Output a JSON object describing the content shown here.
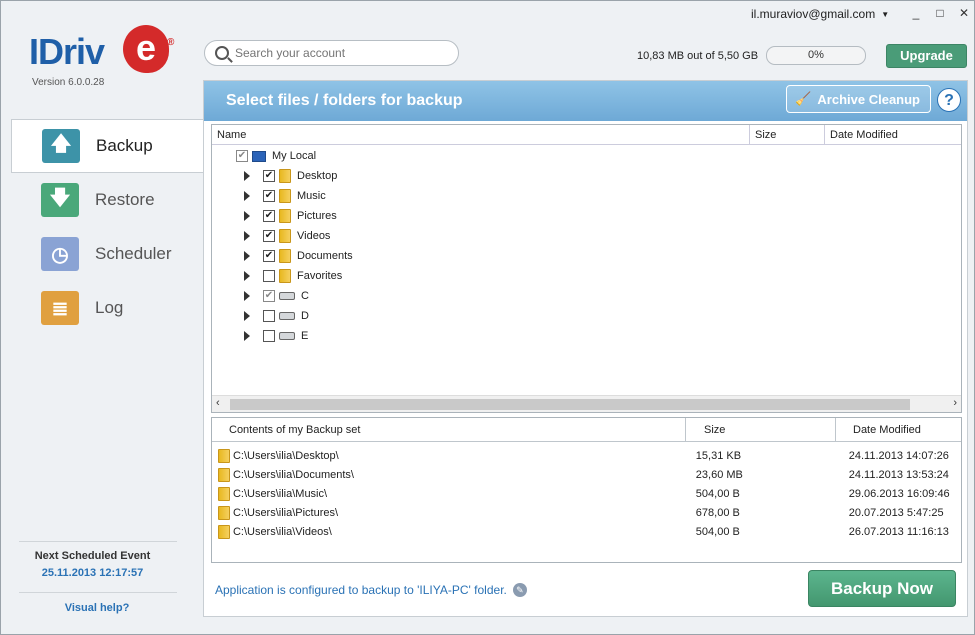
{
  "account": {
    "email": "il.muraviov@gmail.com"
  },
  "window_controls": [
    "_",
    "□",
    "✕"
  ],
  "logo": {
    "text": "IDriv",
    "e": "e",
    "reg": "®",
    "version": "Version  6.0.0.28"
  },
  "search": {
    "placeholder": "Search your account"
  },
  "quota": {
    "text": "10,83 MB out of 5,50 GB",
    "progress_label": "0%",
    "progress_value": 0
  },
  "upgrade_label": "Upgrade",
  "sidebar": {
    "items": [
      {
        "label": "Backup",
        "icon": "backup-arrow-up-icon",
        "active": true
      },
      {
        "label": "Restore",
        "icon": "restore-arrow-down-icon",
        "active": false
      },
      {
        "label": "Scheduler",
        "icon": "clock-icon",
        "active": false
      },
      {
        "label": "Log",
        "icon": "document-icon",
        "active": false
      }
    ],
    "next_event_label": "Next Scheduled Event",
    "next_event_time": "25.11.2013 12:17:57",
    "visual_help": "Visual help?"
  },
  "panel": {
    "title": "Select  files / folders  for  backup",
    "archive_cleanup": "Archive Cleanup",
    "help": "?"
  },
  "tree": {
    "columns": [
      "Name",
      "Size",
      "Date Modified"
    ],
    "root": {
      "label": "My Local",
      "checked": "partial"
    },
    "items": [
      {
        "label": "Desktop",
        "type": "folder",
        "checked": "yes"
      },
      {
        "label": "Music",
        "type": "folder",
        "checked": "yes"
      },
      {
        "label": "Pictures",
        "type": "folder",
        "checked": "yes"
      },
      {
        "label": "Videos",
        "type": "folder",
        "checked": "yes"
      },
      {
        "label": "Documents",
        "type": "folder",
        "checked": "yes"
      },
      {
        "label": "Favorites",
        "type": "folder",
        "checked": "no"
      },
      {
        "label": "C",
        "type": "drive",
        "checked": "partial"
      },
      {
        "label": "D",
        "type": "drive",
        "checked": "no"
      },
      {
        "label": "E",
        "type": "drive",
        "checked": "no"
      }
    ]
  },
  "backup_set": {
    "columns": [
      "Contents of my Backup set",
      "Size",
      "Date Modified"
    ],
    "rows": [
      {
        "path": "C:\\Users\\ilia\\Desktop\\",
        "size": "15,31 KB",
        "date": "24.11.2013 14:07:26"
      },
      {
        "path": "C:\\Users\\ilia\\Documents\\",
        "size": "23,60 MB",
        "date": "24.11.2013 13:53:24"
      },
      {
        "path": "C:\\Users\\ilia\\Music\\",
        "size": "504,00 B",
        "date": "29.06.2013 16:09:46"
      },
      {
        "path": "C:\\Users\\ilia\\Pictures\\",
        "size": "678,00 B",
        "date": "20.07.2013 5:47:25"
      },
      {
        "path": "C:\\Users\\ilia\\Videos\\",
        "size": "504,00 B",
        "date": "26.07.2013 11:16:13"
      }
    ]
  },
  "config_note": "Application is configured to backup to 'ILIYA-PC' folder.",
  "backup_now": "Backup Now"
}
